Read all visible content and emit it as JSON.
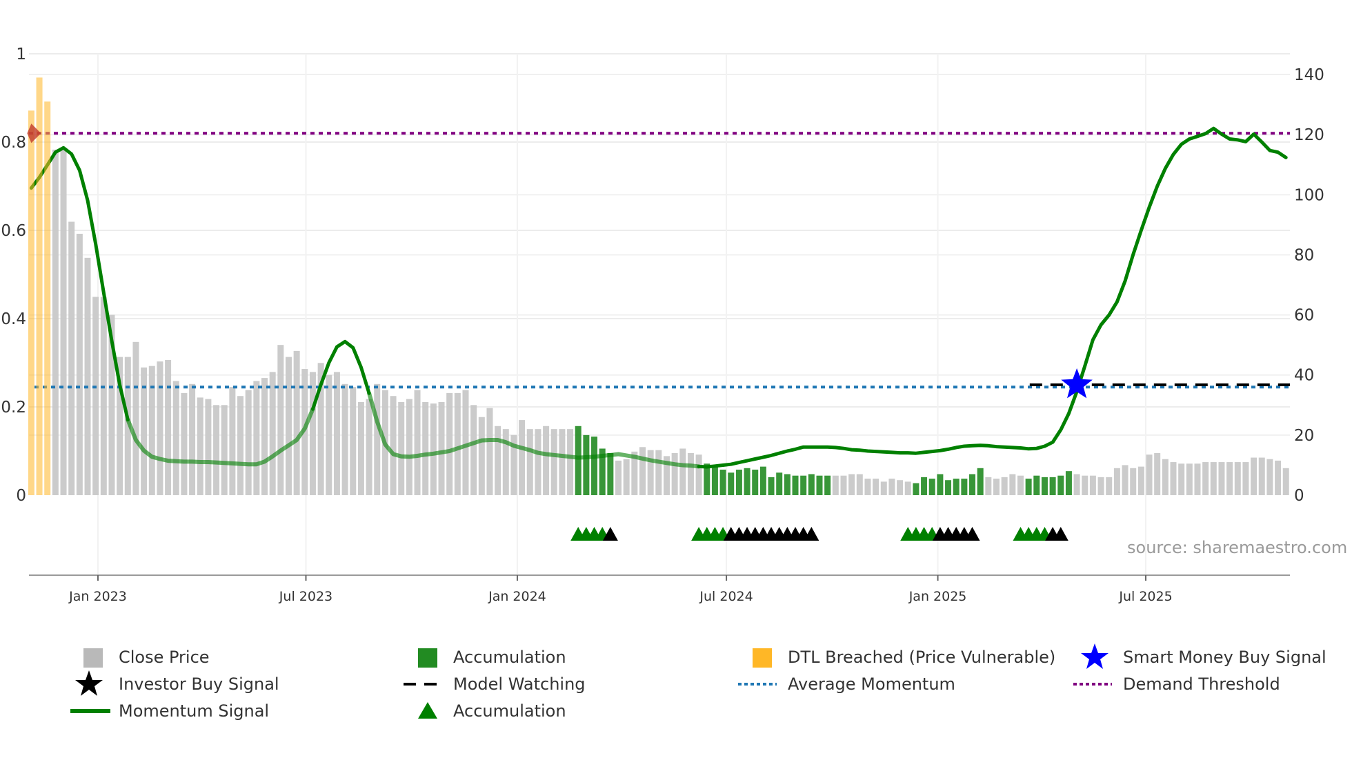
{
  "chart_data": {
    "type": "bar+line",
    "dates": [
      "2022-11-04",
      "2022-11-11",
      "2022-11-18",
      "2022-11-25",
      "2022-12-02",
      "2022-12-09",
      "2022-12-16",
      "2022-12-23",
      "2022-12-30",
      "2023-01-06",
      "2023-01-13",
      "2023-01-20",
      "2023-01-27",
      "2023-02-03",
      "2023-02-10",
      "2023-02-17",
      "2023-02-24",
      "2023-03-03",
      "2023-03-10",
      "2023-03-17",
      "2023-03-24",
      "2023-03-31",
      "2023-04-07",
      "2023-04-14",
      "2023-04-21",
      "2023-04-28",
      "2023-05-05",
      "2023-05-12",
      "2023-05-19",
      "2023-05-26",
      "2023-06-02",
      "2023-06-09",
      "2023-06-16",
      "2023-06-23",
      "2023-06-30",
      "2023-07-07",
      "2023-07-14",
      "2023-07-21",
      "2023-07-28",
      "2023-08-04",
      "2023-08-11",
      "2023-08-18",
      "2023-08-25",
      "2023-09-01",
      "2023-09-08",
      "2023-09-15",
      "2023-09-22",
      "2023-09-29",
      "2023-10-06",
      "2023-10-13",
      "2023-10-20",
      "2023-10-27",
      "2023-11-03",
      "2023-11-10",
      "2023-11-17",
      "2023-11-24",
      "2023-12-01",
      "2023-12-08",
      "2023-12-15",
      "2023-12-22",
      "2023-12-29",
      "2024-01-05",
      "2024-01-12",
      "2024-01-19",
      "2024-01-26",
      "2024-02-02",
      "2024-02-09",
      "2024-02-16",
      "2024-02-23",
      "2024-03-01",
      "2024-03-08",
      "2024-03-15",
      "2024-03-22",
      "2024-03-29",
      "2024-04-05",
      "2024-04-12",
      "2024-04-19",
      "2024-04-26",
      "2024-05-03",
      "2024-05-10",
      "2024-05-17",
      "2024-05-24",
      "2024-05-31",
      "2024-06-07",
      "2024-06-14",
      "2024-06-21",
      "2024-06-28",
      "2024-07-05",
      "2024-07-12",
      "2024-07-19",
      "2024-07-26",
      "2024-08-02",
      "2024-08-09",
      "2024-08-16",
      "2024-08-23",
      "2024-08-30",
      "2024-09-06",
      "2024-09-13",
      "2024-09-20",
      "2024-09-27",
      "2024-10-04",
      "2024-10-11",
      "2024-10-18",
      "2024-10-25",
      "2024-11-01",
      "2024-11-08",
      "2024-11-15",
      "2024-11-22",
      "2024-11-29",
      "2024-12-06",
      "2024-12-13",
      "2024-12-20",
      "2024-12-27",
      "2025-01-03",
      "2025-01-10",
      "2025-01-17",
      "2025-01-24",
      "2025-01-31",
      "2025-02-07",
      "2025-02-14",
      "2025-02-21",
      "2025-02-28",
      "2025-03-07",
      "2025-03-14",
      "2025-03-21",
      "2025-03-28",
      "2025-04-04",
      "2025-04-11",
      "2025-04-18",
      "2025-04-25",
      "2025-05-02",
      "2025-05-09",
      "2025-05-16",
      "2025-05-23",
      "2025-05-30",
      "2025-06-06",
      "2025-06-13",
      "2025-06-20",
      "2025-06-27",
      "2025-07-04",
      "2025-07-11",
      "2025-07-18",
      "2025-07-25",
      "2025-08-01",
      "2025-08-08",
      "2025-08-15",
      "2025-08-22",
      "2025-08-29",
      "2025-09-05",
      "2025-09-12",
      "2025-09-19",
      "2025-09-26",
      "2025-10-03",
      "2025-10-10",
      "2025-10-17",
      "2025-10-24",
      "2025-10-31"
    ],
    "close_price": [
      128,
      139,
      131,
      115,
      115,
      91,
      87,
      79,
      66,
      66,
      60,
      46,
      46,
      51,
      42.5,
      43,
      44.5,
      45,
      38,
      34,
      37,
      32.5,
      32,
      30,
      30,
      36,
      33,
      35,
      38,
      39,
      41,
      50,
      46,
      48,
      42,
      41,
      44,
      40,
      41,
      37,
      36,
      31,
      32,
      37,
      35,
      33,
      31,
      32,
      35,
      31,
      30.5,
      31,
      34,
      34,
      35,
      30,
      26,
      29,
      23,
      22,
      20,
      25,
      22,
      22,
      23,
      22,
      22,
      22,
      23,
      20,
      19.5,
      15.5,
      14,
      11.5,
      12,
      14.5,
      16,
      15,
      15,
      13,
      14,
      15.5,
      14,
      13.5,
      10.5,
      9.5,
      8.5,
      7.5,
      8.5,
      9,
      8.5,
      9.5,
      6,
      7.5,
      7,
      6.5,
      6.5,
      7,
      6.5,
      6.5,
      6.5,
      6.5,
      7,
      7,
      5.5,
      5.5,
      4.5,
      5.5,
      5,
      4.5,
      4,
      6,
      5.5,
      7,
      5,
      5.5,
      5.5,
      7,
      9,
      6,
      5.5,
      6,
      7,
      6.5,
      5.5,
      6.5,
      6,
      6,
      6.5,
      8,
      7,
      6.5,
      6.5,
      6,
      6,
      9,
      10,
      9,
      9.5,
      13.5,
      14,
      12,
      11,
      10.5,
      10.5,
      10.5,
      11,
      11,
      11,
      11,
      11,
      11,
      12.5,
      12.5,
      12,
      11.5,
      9
    ],
    "bar_category": [
      "dtl",
      "dtl",
      "dtl",
      "close",
      "close",
      "close",
      "close",
      "close",
      "close",
      "close",
      "close",
      "close",
      "close",
      "close",
      "close",
      "close",
      "close",
      "close",
      "close",
      "close",
      "close",
      "close",
      "close",
      "close",
      "close",
      "close",
      "close",
      "close",
      "close",
      "close",
      "close",
      "close",
      "close",
      "close",
      "close",
      "close",
      "close",
      "close",
      "close",
      "close",
      "close",
      "close",
      "close",
      "close",
      "close",
      "close",
      "close",
      "close",
      "close",
      "close",
      "close",
      "close",
      "close",
      "close",
      "close",
      "close",
      "close",
      "close",
      "close",
      "close",
      "close",
      "close",
      "close",
      "close",
      "close",
      "close",
      "close",
      "close",
      "accumulation",
      "accumulation",
      "accumulation",
      "accumulation",
      "accumulation",
      "close",
      "close",
      "close",
      "close",
      "close",
      "close",
      "close",
      "close",
      "close",
      "close",
      "close",
      "accumulation",
      "accumulation",
      "accumulation",
      "accumulation",
      "accumulation",
      "accumulation",
      "accumulation",
      "accumulation",
      "accumulation",
      "accumulation",
      "accumulation",
      "accumulation",
      "accumulation",
      "accumulation",
      "accumulation",
      "accumulation",
      "close",
      "close",
      "close",
      "close",
      "close",
      "close",
      "close",
      "close",
      "close",
      "close",
      "accumulation",
      "accumulation",
      "accumulation",
      "accumulation",
      "accumulation",
      "accumulation",
      "accumulation",
      "accumulation",
      "accumulation",
      "close",
      "close",
      "close",
      "close",
      "close",
      "accumulation",
      "accumulation",
      "accumulation",
      "accumulation",
      "accumulation",
      "accumulation",
      "close",
      "close",
      "close",
      "close",
      "close",
      "close",
      "close",
      "close",
      "close",
      "close",
      "close",
      "close",
      "close",
      "close",
      "close",
      "close",
      "close",
      "close",
      "close",
      "close",
      "close",
      "close",
      "close",
      "close",
      "close",
      "close",
      "close"
    ],
    "momentum": [
      0.696,
      0.72,
      0.748,
      0.777,
      0.787,
      0.773,
      0.736,
      0.668,
      0.569,
      0.459,
      0.35,
      0.25,
      0.171,
      0.125,
      0.101,
      0.087,
      0.082,
      0.078,
      0.077,
      0.076,
      0.076,
      0.075,
      0.075,
      0.074,
      0.073,
      0.072,
      0.071,
      0.07,
      0.07,
      0.076,
      0.088,
      0.101,
      0.113,
      0.125,
      0.151,
      0.195,
      0.25,
      0.3,
      0.336,
      0.348,
      0.334,
      0.29,
      0.231,
      0.167,
      0.115,
      0.093,
      0.088,
      0.087,
      0.089,
      0.092,
      0.094,
      0.097,
      0.1,
      0.106,
      0.112,
      0.118,
      0.124,
      0.125,
      0.125,
      0.12,
      0.112,
      0.107,
      0.102,
      0.096,
      0.093,
      0.091,
      0.089,
      0.087,
      0.085,
      0.086,
      0.087,
      0.089,
      0.091,
      0.093,
      0.09,
      0.087,
      0.083,
      0.079,
      0.076,
      0.073,
      0.07,
      0.068,
      0.067,
      0.065,
      0.064,
      0.066,
      0.068,
      0.07,
      0.074,
      0.078,
      0.082,
      0.086,
      0.09,
      0.095,
      0.1,
      0.104,
      0.109,
      0.109,
      0.109,
      0.109,
      0.108,
      0.106,
      0.103,
      0.102,
      0.1,
      0.099,
      0.098,
      0.097,
      0.096,
      0.096,
      0.095,
      0.097,
      0.099,
      0.101,
      0.104,
      0.108,
      0.111,
      0.112,
      0.113,
      0.112,
      0.11,
      0.109,
      0.108,
      0.107,
      0.105,
      0.106,
      0.111,
      0.12,
      0.148,
      0.185,
      0.235,
      0.293,
      0.352,
      0.386,
      0.408,
      0.438,
      0.485,
      0.545,
      0.6,
      0.652,
      0.7,
      0.74,
      0.772,
      0.795,
      0.807,
      0.813,
      0.819,
      0.831,
      0.818,
      0.807,
      0.805,
      0.801,
      0.818,
      0.8,
      0.781,
      0.777,
      0.765
    ],
    "demand_threshold": 0.82,
    "average_momentum": 0.245,
    "model_watching": {
      "start": "2025-03-22",
      "end": "2025-10-31",
      "value": 0.25
    },
    "smart_money_buy_signal": [
      {
        "date": "2025-05-02",
        "value": 0.25
      }
    ],
    "threshold_marker": {
      "date": "2022-11-04",
      "value": 0.82
    },
    "accumulation_signals": [
      "2024-02-23",
      "2024-03-01",
      "2024-03-08",
      "2024-03-15",
      "2024-06-07",
      "2024-06-14",
      "2024-06-21",
      "2024-06-28",
      "2024-12-06",
      "2024-12-13",
      "2024-12-20",
      "2024-12-27",
      "2025-03-14",
      "2025-03-21",
      "2025-03-28",
      "2025-04-04"
    ],
    "investor_buy_signals": [
      "2024-03-22",
      "2024-07-05",
      "2024-07-12",
      "2024-07-19",
      "2024-07-26",
      "2024-08-02",
      "2024-08-09",
      "2024-08-16",
      "2024-08-23",
      "2024-08-30",
      "2024-09-06",
      "2024-09-13",
      "2025-01-03",
      "2025-01-10",
      "2025-01-17",
      "2025-01-24",
      "2025-01-31",
      "2025-04-11",
      "2025-04-18"
    ],
    "x_axis": {
      "ticks": [
        {
          "date": "2023-01-01",
          "label": "Jan 2023"
        },
        {
          "date": "2023-07-01",
          "label": "Jul 2023"
        },
        {
          "date": "2024-01-01",
          "label": "Jan 2024"
        },
        {
          "date": "2024-07-01",
          "label": "Jul 2024"
        },
        {
          "date": "2025-01-01",
          "label": "Jan 2025"
        },
        {
          "date": "2025-07-01",
          "label": "Jul 2025"
        }
      ]
    },
    "y_left": {
      "range": [
        0,
        1.0
      ],
      "ticks": [
        {
          "value": 0,
          "label": "0"
        },
        {
          "value": 0.2,
          "label": "0.2"
        },
        {
          "value": 0.4,
          "label": "0.4"
        },
        {
          "value": 0.6,
          "label": "0.6"
        },
        {
          "value": 0.8,
          "label": "0.8"
        },
        {
          "value": 1,
          "label": "1"
        }
      ]
    },
    "y_right": {
      "range": [
        0,
        146.9
      ],
      "ticks": [
        {
          "value": 0,
          "label": "0"
        },
        {
          "value": 20,
          "label": "20"
        },
        {
          "value": 40,
          "label": "40"
        },
        {
          "value": 60,
          "label": "60"
        },
        {
          "value": 80,
          "label": "80"
        },
        {
          "value": 100,
          "label": "100"
        },
        {
          "value": 120,
          "label": "120"
        },
        {
          "value": 140,
          "label": "140"
        }
      ]
    },
    "grid": true,
    "legend_placement": "bottom",
    "colors": {
      "close_price": "#c8c8c8",
      "accumulation_bar": "#228b22",
      "dtl_breached": "#ffb726",
      "momentum": "#008000",
      "average_momentum": "#1f77b4",
      "demand_threshold": "#800080",
      "model_watching": "#000000",
      "smart_money": "#0000ff",
      "investor_buy": "#000000",
      "accumulation_signal": "#008000",
      "threshold_marker": "#c0392b"
    }
  },
  "legend": {
    "close_price": "Close Price",
    "accumulation_bar": "Accumulation",
    "dtl_breached": "DTL Breached (Price Vulnerable)",
    "smart_money": "Smart Money Buy Signal",
    "investor_buy": "Investor Buy Signal",
    "model_watching": "Model Watching",
    "average_momentum": "Average Momentum",
    "demand_threshold": "Demand Threshold",
    "momentum": "Momentum Signal",
    "accumulation_signal": "Accumulation"
  },
  "source": "source: sharemaestro.com"
}
